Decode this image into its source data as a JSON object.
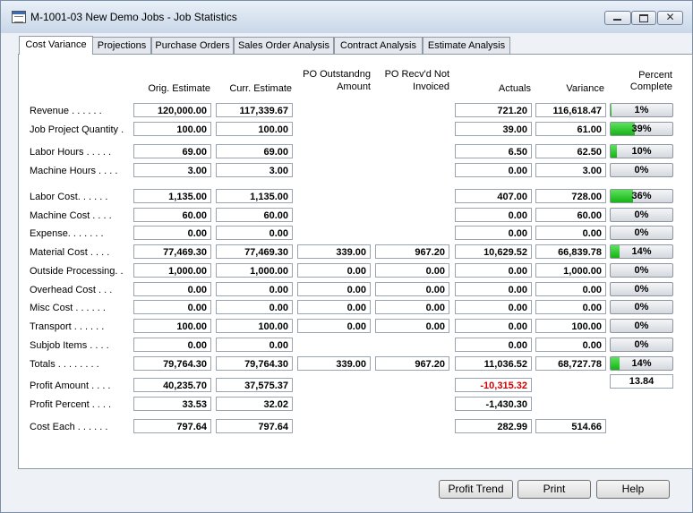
{
  "window": {
    "title": "M-1001-03 New Demo Jobs - Job Statistics",
    "close_glyph": "✕"
  },
  "tabs": [
    {
      "label": "Cost Variance",
      "active": true
    },
    {
      "label": "Projections",
      "active": false
    },
    {
      "label": "Purchase Orders",
      "active": false
    },
    {
      "label": "Sales Order Analysis",
      "active": false
    },
    {
      "label": "Contract Analysis",
      "active": false
    },
    {
      "label": "Estimate Analysis",
      "active": false
    }
  ],
  "columns": {
    "orig": "Orig. Estimate",
    "curr": "Curr. Estimate",
    "po_out_1": "PO Outstandng",
    "po_out_2": "Amount",
    "po_recv_1": "PO Recv'd Not",
    "po_recv_2": "Invoiced",
    "actuals": "Actuals",
    "variance": "Variance",
    "percent_1": "Percent",
    "percent_2": "Complete"
  },
  "rows": [
    {
      "label": "Revenue . . . . . .",
      "orig": "120,000.00",
      "curr": "117,339.67",
      "po_out": null,
      "po_recv": null,
      "actuals": "721.20",
      "variance": "116,618.47",
      "percent": "1%",
      "percent_value": 1
    },
    {
      "label": "Job Project Quantity .",
      "orig": "100.00",
      "curr": "100.00",
      "po_out": null,
      "po_recv": null,
      "actuals": "39.00",
      "variance": "61.00",
      "percent": "39%",
      "percent_value": 39
    },
    {
      "label": "Labor Hours . . . . .",
      "orig": "69.00",
      "curr": "69.00",
      "po_out": null,
      "po_recv": null,
      "actuals": "6.50",
      "variance": "62.50",
      "percent": "10%",
      "percent_value": 10
    },
    {
      "label": "Machine Hours . . . .",
      "orig": "3.00",
      "curr": "3.00",
      "po_out": null,
      "po_recv": null,
      "actuals": "0.00",
      "variance": "3.00",
      "percent": "0%",
      "percent_value": 0
    },
    {
      "label": "Labor Cost. . . . . .",
      "orig": "1,135.00",
      "curr": "1,135.00",
      "po_out": null,
      "po_recv": null,
      "actuals": "407.00",
      "variance": "728.00",
      "percent": "36%",
      "percent_value": 36
    },
    {
      "label": "Machine Cost . . . .",
      "orig": "60.00",
      "curr": "60.00",
      "po_out": null,
      "po_recv": null,
      "actuals": "0.00",
      "variance": "60.00",
      "percent": "0%",
      "percent_value": 0
    },
    {
      "label": "Expense. . . . . . .",
      "orig": "0.00",
      "curr": "0.00",
      "po_out": null,
      "po_recv": null,
      "actuals": "0.00",
      "variance": "0.00",
      "percent": "0%",
      "percent_value": 0
    },
    {
      "label": "Material Cost . . . .",
      "orig": "77,469.30",
      "curr": "77,469.30",
      "po_out": "339.00",
      "po_recv": "967.20",
      "actuals": "10,629.52",
      "variance": "66,839.78",
      "percent": "14%",
      "percent_value": 14
    },
    {
      "label": "Outside Processing. .",
      "orig": "1,000.00",
      "curr": "1,000.00",
      "po_out": "0.00",
      "po_recv": "0.00",
      "actuals": "0.00",
      "variance": "1,000.00",
      "percent": "0%",
      "percent_value": 0
    },
    {
      "label": "Overhead Cost . . .",
      "orig": "0.00",
      "curr": "0.00",
      "po_out": "0.00",
      "po_recv": "0.00",
      "actuals": "0.00",
      "variance": "0.00",
      "percent": "0%",
      "percent_value": 0
    },
    {
      "label": "Misc Cost . . . . . .",
      "orig": "0.00",
      "curr": "0.00",
      "po_out": "0.00",
      "po_recv": "0.00",
      "actuals": "0.00",
      "variance": "0.00",
      "percent": "0%",
      "percent_value": 0
    },
    {
      "label": "Transport . . . . . .",
      "orig": "100.00",
      "curr": "100.00",
      "po_out": "0.00",
      "po_recv": "0.00",
      "actuals": "0.00",
      "variance": "100.00",
      "percent": "0%",
      "percent_value": 0
    },
    {
      "label": "Subjob Items . . . .",
      "orig": "0.00",
      "curr": "0.00",
      "po_out": null,
      "po_recv": null,
      "actuals": "0.00",
      "variance": "0.00",
      "percent": "0%",
      "percent_value": 0
    },
    {
      "label": "Totals . . . . . . . .",
      "orig": "79,764.30",
      "curr": "79,764.30",
      "po_out": "339.00",
      "po_recv": "967.20",
      "actuals": "11,036.52",
      "variance": "68,727.78",
      "percent": "14%",
      "percent_value": 14
    }
  ],
  "profit": {
    "amount_label": "Profit Amount . . . .",
    "amount_orig": "40,235.70",
    "amount_curr": "37,575.37",
    "amount_actuals": "-10,315.32",
    "amount_extra": "13.84",
    "percent_label": "Profit Percent . . . .",
    "percent_orig": "33.53",
    "percent_curr": "32.02",
    "percent_actuals": "-1,430.30",
    "cost_each_label": "Cost Each . . . . . .",
    "cost_each_orig": "797.64",
    "cost_each_curr": "797.64",
    "cost_each_actuals": "282.99",
    "cost_each_variance": "514.66"
  },
  "buttons": {
    "profit_trend": "Profit Trend",
    "print": "Print",
    "help": "Help"
  },
  "colors": {
    "progress_fill": "#15b315",
    "negative": "#d00000"
  }
}
